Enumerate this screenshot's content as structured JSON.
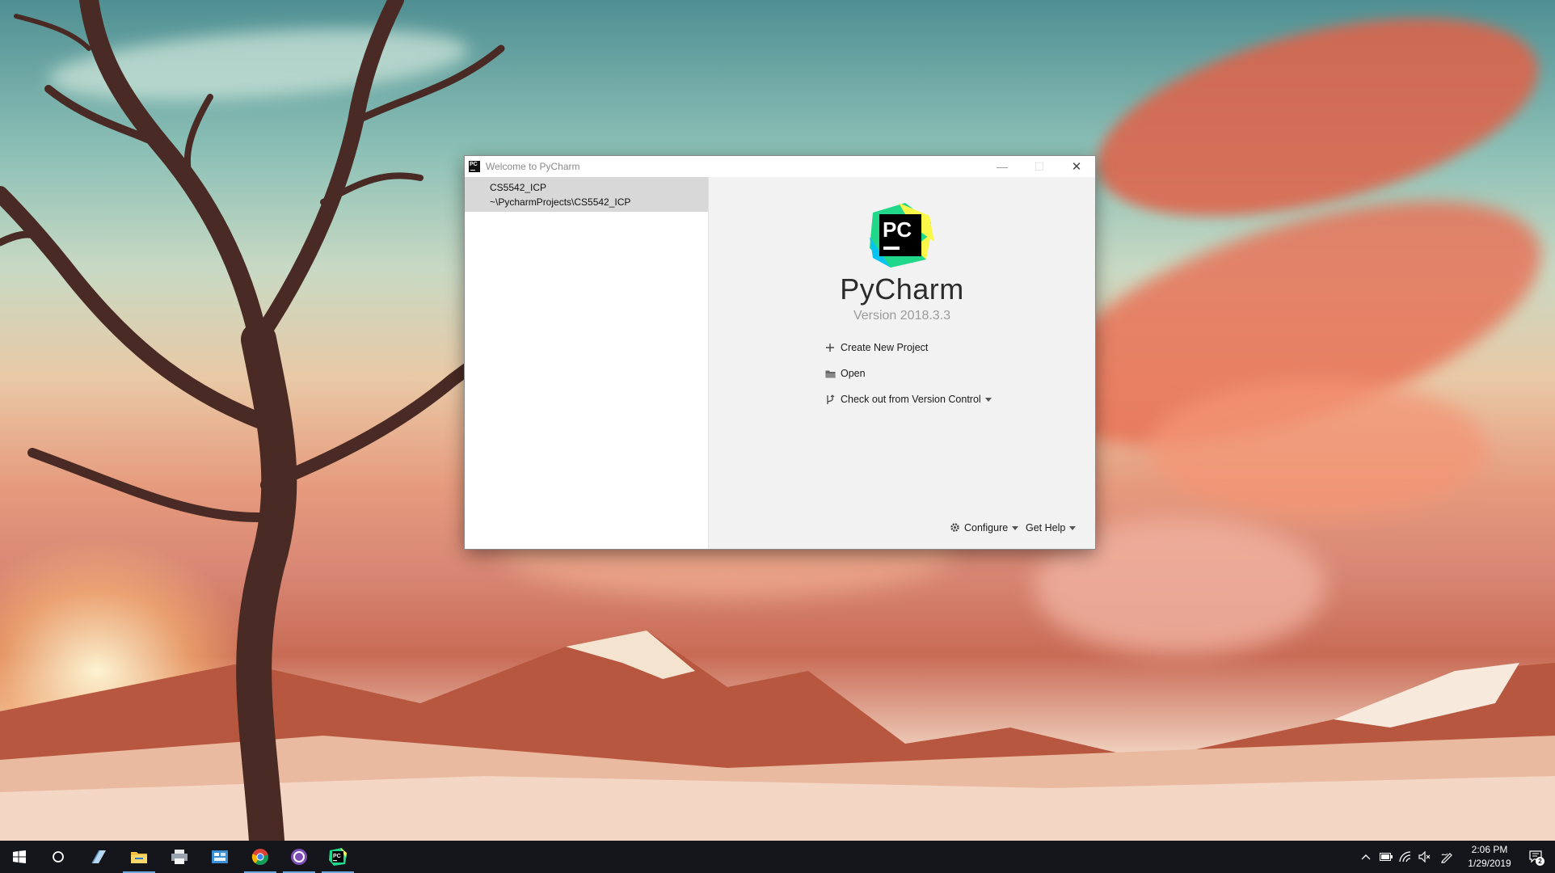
{
  "window": {
    "title": "Welcome to PyCharm",
    "controls": {
      "minimize": "—",
      "maximize": "☐",
      "close": "✕"
    }
  },
  "recent_projects": [
    {
      "name": "CS5542_ICP",
      "path": "~\\PycharmProjects\\CS5542_ICP"
    }
  ],
  "welcome": {
    "app_name": "PyCharm",
    "version": "Version 2018.3.3",
    "logo_text": "PC",
    "actions": {
      "create_new_project": "Create New Project",
      "open": "Open",
      "checkout_vcs": "Check out from Version Control"
    },
    "footer": {
      "configure": "Configure",
      "get_help": "Get Help"
    }
  },
  "taskbar": {
    "apps": [
      "start-icon",
      "cortana-icon",
      "notepad-icon",
      "file-explorer-icon",
      "printer-icon",
      "store-icon",
      "chrome-icon",
      "app-icon",
      "pycharm-icon"
    ],
    "clock": {
      "time": "2:06 PM",
      "date": "1/29/2019"
    },
    "notification_count": "2"
  },
  "colors": {
    "accent": "#6fa8dc",
    "taskbar_bg": "#14161b",
    "selection_bg": "#d8d8d8",
    "pane_bg": "#f2f2f2"
  }
}
